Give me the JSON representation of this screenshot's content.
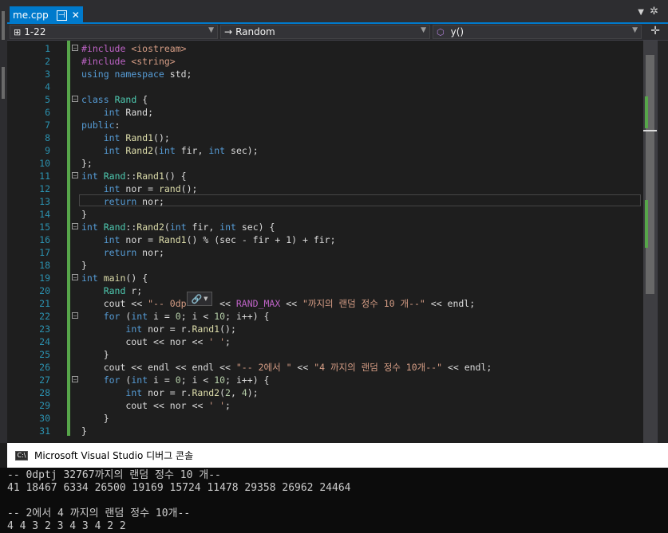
{
  "tab": {
    "title": "me.cpp",
    "pin_icon": "pin-icon",
    "close_icon": "close-icon"
  },
  "navbar": {
    "scope": "1-22",
    "class": "Random",
    "member": "y()"
  },
  "popup": {
    "icon": "link-icon"
  },
  "code_lines": [
    {
      "n": "1",
      "html": "<span class=\"m\">#include</span> <span class=\"s\">&lt;iostream&gt;</span>",
      "fold": "⊟"
    },
    {
      "n": "2",
      "html": "<span class=\"m\">#include</span> <span class=\"s\">&lt;string&gt;</span>",
      "fold": ""
    },
    {
      "n": "3",
      "html": "<span class=\"k\">using namespace</span> std;",
      "fold": ""
    },
    {
      "n": "4",
      "html": "",
      "fold": ""
    },
    {
      "n": "5",
      "html": "<span class=\"k\">class</span> <span class=\"t\">Rand</span> {",
      "fold": "⊟"
    },
    {
      "n": "6",
      "html": "    <span class=\"k\">int</span> Rand;",
      "fold": ""
    },
    {
      "n": "7",
      "html": "<span class=\"k\">public</span>:",
      "fold": ""
    },
    {
      "n": "8",
      "html": "    <span class=\"k\">int</span> <span class=\"f\">Rand1</span>();",
      "fold": ""
    },
    {
      "n": "9",
      "html": "    <span class=\"k\">int</span> <span class=\"f\">Rand2</span>(<span class=\"k\">int</span> fir, <span class=\"k\">int</span> sec);",
      "fold": ""
    },
    {
      "n": "10",
      "html": "};",
      "fold": ""
    },
    {
      "n": "11",
      "html": "<span class=\"k\">int</span> <span class=\"t\">Rand</span>::<span class=\"f\">Rand1</span>() {",
      "fold": "⊟"
    },
    {
      "n": "12",
      "html": "    <span class=\"k\">int</span> nor = <span class=\"f\">rand</span>();",
      "fold": ""
    },
    {
      "n": "13",
      "html": "    <span class=\"k\">return</span> nor;",
      "fold": ""
    },
    {
      "n": "14",
      "html": "}",
      "fold": ""
    },
    {
      "n": "15",
      "html": "<span class=\"k\">int</span> <span class=\"t\">Rand</span>::<span class=\"f\">Rand2</span>(<span class=\"k\">int</span> fir, <span class=\"k\">int</span> sec) {",
      "fold": "⊟"
    },
    {
      "n": "16",
      "html": "    <span class=\"k\">int</span> nor = <span class=\"f\">Rand1</span>() % (sec - fir + 1) + fir;",
      "fold": ""
    },
    {
      "n": "17",
      "html": "    <span class=\"k\">return</span> nor;",
      "fold": ""
    },
    {
      "n": "18",
      "html": "}",
      "fold": ""
    },
    {
      "n": "19",
      "html": "<span class=\"k\">int</span> <span class=\"f\">main</span>() {",
      "fold": "⊟"
    },
    {
      "n": "20",
      "html": "    <span class=\"t\">Rand</span> r;",
      "fold": ""
    },
    {
      "n": "21",
      "html": "    cout &lt;&lt; <span class=\"s\">\"-- 0dp</span>      &lt;&lt; <span class=\"m\">RAND_MAX</span> &lt;&lt; <span class=\"s\">\"까지의 랜덤 정수 10 개--\"</span> &lt;&lt; endl;",
      "fold": ""
    },
    {
      "n": "22",
      "html": "    <span class=\"k\">for</span> (<span class=\"k\">int</span> i = <span class=\"n\">0</span>; i &lt; <span class=\"n\">10</span>; i++) {",
      "fold": "⊟"
    },
    {
      "n": "23",
      "html": "        <span class=\"k\">int</span> nor = r.<span class=\"f\">Rand1</span>();",
      "fold": ""
    },
    {
      "n": "24",
      "html": "        cout &lt;&lt; nor &lt;&lt; <span class=\"s\">' '</span>;",
      "fold": ""
    },
    {
      "n": "25",
      "html": "    }",
      "fold": ""
    },
    {
      "n": "26",
      "html": "    cout &lt;&lt; endl &lt;&lt; endl &lt;&lt; <span class=\"s\">\"-- 2에서 \"</span> &lt;&lt; <span class=\"s\">\"4 까지의 랜덤 정수 10개--\"</span> &lt;&lt; endl;",
      "fold": ""
    },
    {
      "n": "27",
      "html": "    <span class=\"k\">for</span> (<span class=\"k\">int</span> i = <span class=\"n\">0</span>; i &lt; <span class=\"n\">10</span>; i++) {",
      "fold": "⊟"
    },
    {
      "n": "28",
      "html": "        <span class=\"k\">int</span> nor = r.<span class=\"f\">Rand2</span>(<span class=\"n\">2</span>, <span class=\"n\">4</span>);",
      "fold": ""
    },
    {
      "n": "29",
      "html": "        cout &lt;&lt; nor &lt;&lt; <span class=\"s\">' '</span>;",
      "fold": ""
    },
    {
      "n": "30",
      "html": "    }",
      "fold": ""
    },
    {
      "n": "31",
      "html": "}",
      "fold": ""
    }
  ],
  "console": {
    "title": "Microsoft Visual Studio 디버그 콘솔",
    "icon": "console-icon",
    "lines": [
      "-- 0dptj 32767까지의 랜덤 정수 10 개--",
      "41 18467 6334 26500 19169 15724 11478 29358 26962 24464",
      "",
      "-- 2에서 4 까지의 랜덤 정수 10개--",
      "4 4 3 2 3 4 3 4 2 2"
    ]
  }
}
